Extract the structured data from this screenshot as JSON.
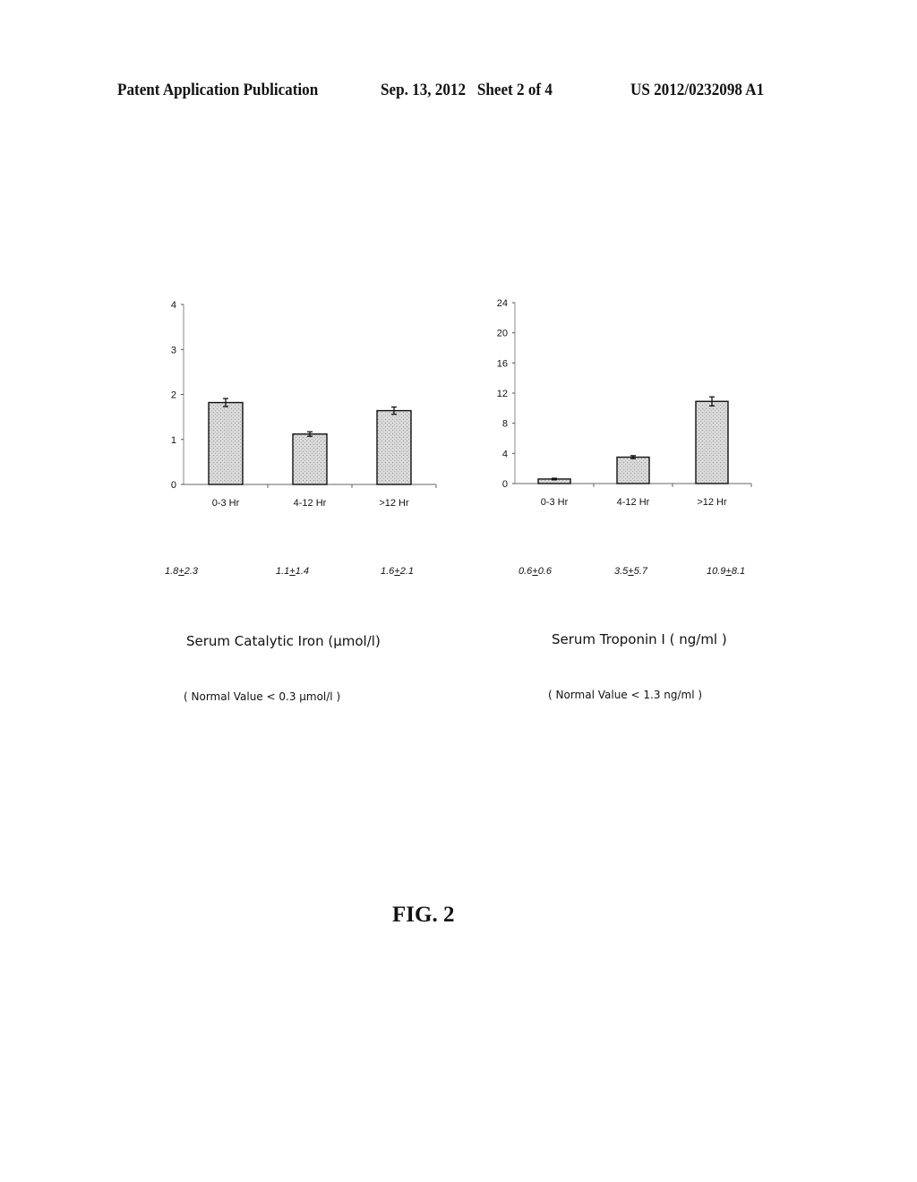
{
  "header": {
    "publication": "Patent Application Publication",
    "date_sheet": "Sep. 13, 2012   Sheet 2 of 4",
    "patent_number": "US 2012/0232098 A1"
  },
  "chart_data": [
    {
      "type": "bar",
      "title": "Serum Catalytic Iron (µmol/l)",
      "subtitle": "( Normal Value < 0.3 µmol/l )",
      "xlabel": "",
      "ylabel": "",
      "categories": [
        "0-3 Hr",
        "4-12 Hr",
        ">12 Hr"
      ],
      "values": [
        1.82,
        1.12,
        1.64
      ],
      "error_bars": [
        0.09,
        0.05,
        0.08
      ],
      "ylim": [
        0,
        4
      ],
      "yticks": [
        0,
        1,
        2,
        3,
        4
      ],
      "grid": false,
      "annotations": [
        {
          "mean": "1.8",
          "pm": "+",
          "sd": "2.3"
        },
        {
          "mean": "1.1",
          "pm": "+",
          "sd": "1.4"
        },
        {
          "mean": "1.6",
          "pm": "+",
          "sd": "2.1"
        }
      ]
    },
    {
      "type": "bar",
      "title": "Serum Troponin I ( ng/ml )",
      "subtitle": "( Normal Value < 1.3 ng/ml )",
      "xlabel": "",
      "ylabel": "",
      "categories": [
        "0-3 Hr",
        "4-12 Hr",
        ">12 Hr"
      ],
      "values": [
        0.6,
        3.5,
        10.9
      ],
      "error_bars": [
        0.1,
        0.2,
        0.6
      ],
      "ylim": [
        0,
        24
      ],
      "yticks": [
        0,
        4,
        8,
        12,
        16,
        20,
        24
      ],
      "grid": false,
      "annotations": [
        {
          "mean": "0.6",
          "pm": "+",
          "sd": "0.6"
        },
        {
          "mean": "3.5",
          "pm": "+",
          "sd": "5.7"
        },
        {
          "mean": "10.9",
          "pm": "+",
          "sd": "8.1"
        }
      ]
    }
  ],
  "figure_label": "FIG. 2",
  "colors": {
    "bar_fill": "#d6d6d6",
    "bar_stroke": "#111111",
    "axis": "#444444"
  }
}
